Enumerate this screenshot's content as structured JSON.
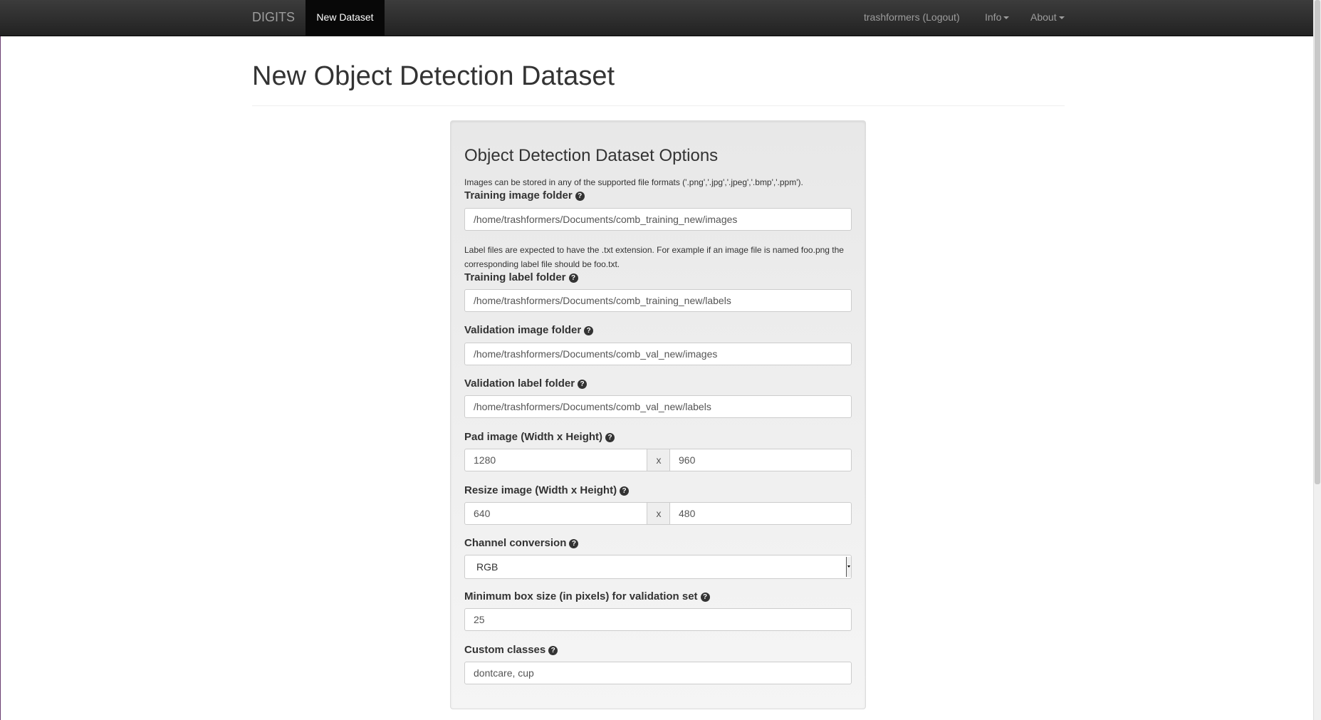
{
  "navbar": {
    "brand": "DIGITS",
    "active_item": "New Dataset",
    "user_link": "trashformers (Logout)",
    "info_menu": "Info",
    "about_menu": "About"
  },
  "page": {
    "title": "New Object Detection Dataset"
  },
  "panel": {
    "title": "Object Detection Dataset Options",
    "image_formats_help": "Images can be stored in any of the supported file formats ('.png','.jpg','.jpeg','.bmp','.ppm').",
    "training_image_folder": {
      "label": "Training image folder",
      "value": "/home/trashformers/Documents/comb_training_new/images"
    },
    "label_help": "Label files are expected to have the .txt extension. For example if an image file is named foo.png the corresponding label file should be foo.txt.",
    "training_label_folder": {
      "label": "Training label folder",
      "value": "/home/trashformers/Documents/comb_training_new/labels"
    },
    "validation_image_folder": {
      "label": "Validation image folder",
      "value": "/home/trashformers/Documents/comb_val_new/images"
    },
    "validation_label_folder": {
      "label": "Validation label folder",
      "value": "/home/trashformers/Documents/comb_val_new/labels"
    },
    "pad_image": {
      "label": "Pad image (Width x Height)",
      "width": "1280",
      "separator": "x",
      "height": "960"
    },
    "resize_image": {
      "label": "Resize image (Width x Height)",
      "width": "640",
      "separator": "x",
      "height": "480"
    },
    "channel_conversion": {
      "label": "Channel conversion",
      "selected": "RGB"
    },
    "min_box_size": {
      "label": "Minimum box size (in pixels) for validation set",
      "value": "25"
    },
    "custom_classes": {
      "label": "Custom classes",
      "value": "dontcare, cup"
    },
    "help_icon_glyph": "?"
  },
  "icons": {
    "help": "question-circle-icon",
    "dropdown": "caret-down-icon"
  },
  "colors": {
    "navbar_bg": "#222222",
    "navbar_active": "#080808",
    "panel_bg": "#eeeeee"
  }
}
